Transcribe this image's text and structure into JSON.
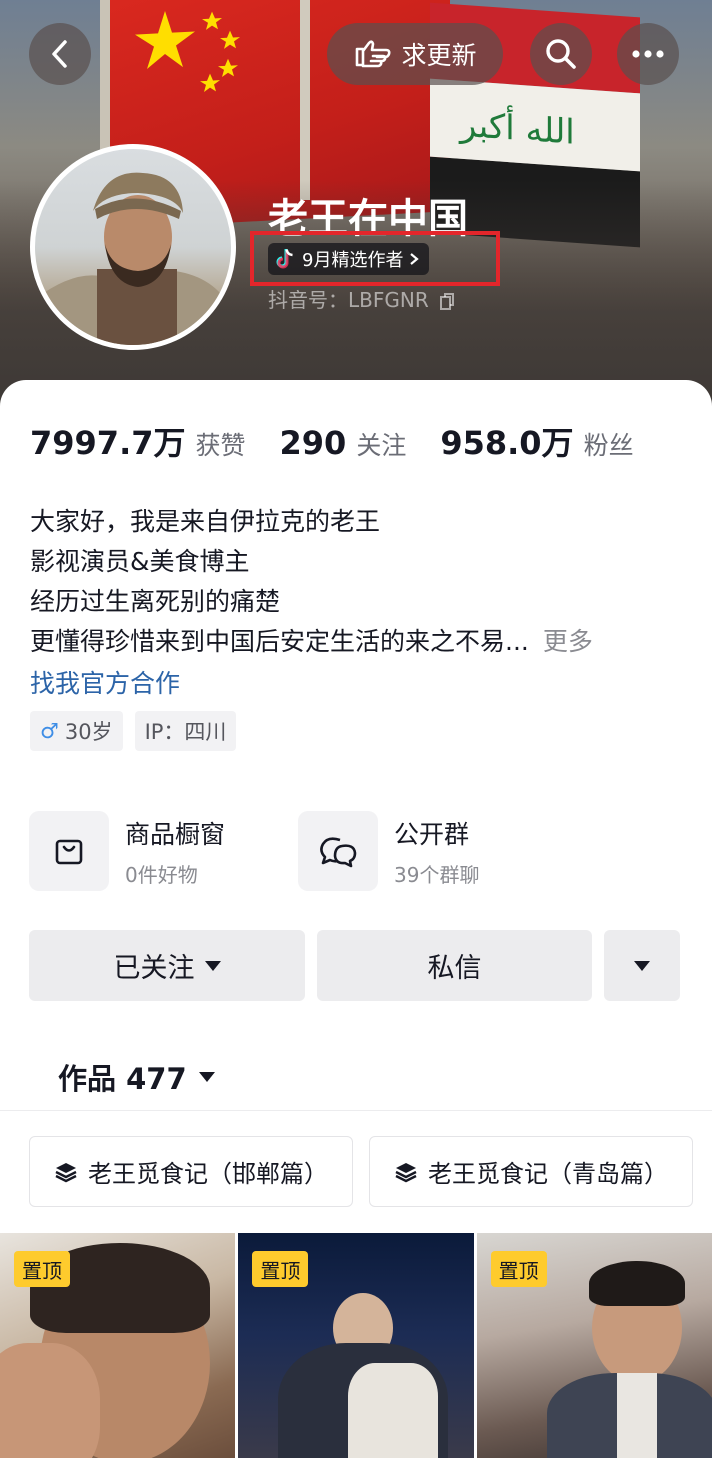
{
  "header": {
    "request_update_label": "求更新",
    "nickname": "老王在中国",
    "badge_text": "9月精选作者",
    "douyin_id": "抖音号：LBFGNR"
  },
  "stats": [
    {
      "value": "7997.7万",
      "label": "获赞"
    },
    {
      "value": "290",
      "label": "关注"
    },
    {
      "value": "958.0万",
      "label": "粉丝"
    }
  ],
  "bio": {
    "lines": [
      "大家好，我是来自伊拉克的老王",
      "影视演员&美食博主",
      "经历过生离死别的痛楚",
      "更懂得珍惜来到中国后安定生活的来之不易..."
    ],
    "more_label": "更多",
    "cooperation_link": "找我官方合作"
  },
  "tags": {
    "age": "30岁",
    "ip": "IP：四川"
  },
  "shortcuts": {
    "shop": {
      "title": "商品橱窗",
      "subtitle": "0件好物"
    },
    "group": {
      "title": "公开群",
      "subtitle": "39个群聊"
    }
  },
  "actions": {
    "followed_label": "已关注",
    "message_label": "私信"
  },
  "works": {
    "tab_label": "作品 477"
  },
  "collections": [
    "老王觅食记（邯郸篇）",
    "老王觅食记（青岛篇）"
  ],
  "videos": [
    {
      "pin_label": "置顶"
    },
    {
      "pin_label": "置顶"
    },
    {
      "pin_label": "置顶"
    }
  ],
  "colors": {
    "highlight_box": "#e3262b",
    "link": "#2c64a8",
    "pin_badge": "#fecb2d"
  }
}
